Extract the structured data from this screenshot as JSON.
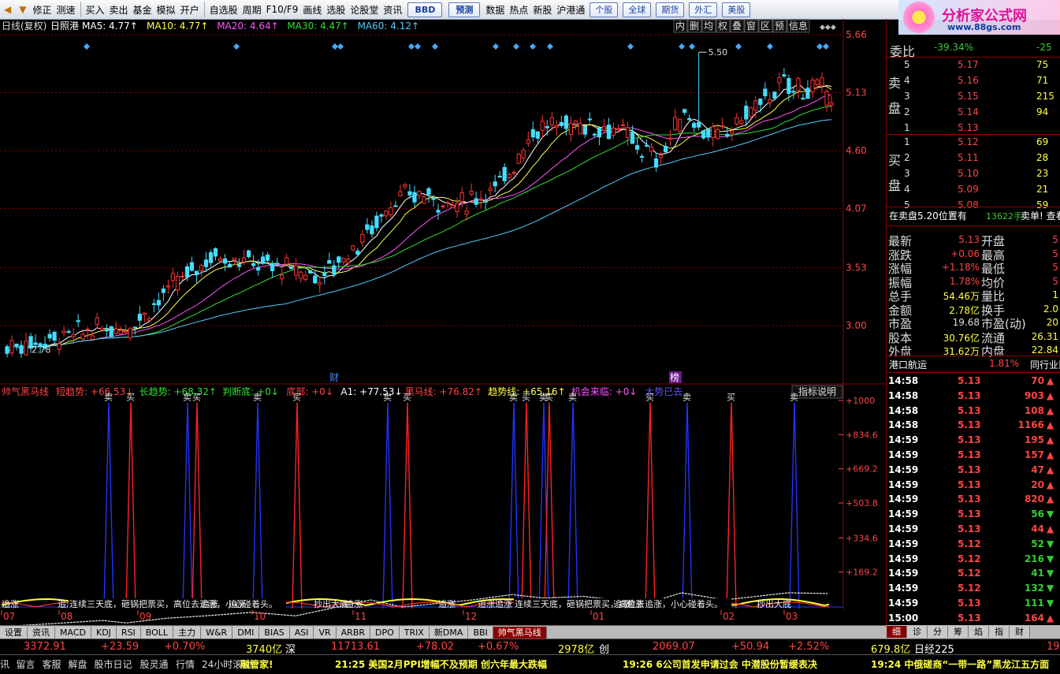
{
  "toolbar": {
    "items": [
      "修正",
      "测速",
      "买入",
      "卖出",
      "基金",
      "模拟",
      "开户",
      "自选股",
      "周期",
      "F10/F9",
      "画线",
      "选股",
      "论股堂",
      "资讯",
      "BBD",
      "预测",
      "数据",
      "热点",
      "新股",
      "沪港通",
      "个股",
      "全球",
      "期货",
      "外汇",
      "美股"
    ]
  },
  "logo": {
    "title": "分析家公式网",
    "url": "www.88gs.com"
  },
  "main_chart": {
    "header": [
      {
        "text": "日线(复权)",
        "color": "#dddddd"
      },
      {
        "text": "日照港",
        "color": "#ffffff"
      },
      {
        "text": "MA5: 4.77↑",
        "color": "#ffffff"
      },
      {
        "text": "MA10: 4.77↑",
        "color": "#ffff44"
      },
      {
        "text": "MA20: 4.64↑",
        "color": "#ff55ff"
      },
      {
        "text": "MA30: 4.47↑",
        "color": "#33dd33"
      },
      {
        "text": "MA60: 4.12↑",
        "color": "#55ccff"
      }
    ],
    "toolbar_icons": [
      "内",
      "删",
      "均",
      "权",
      "叠",
      "窗",
      "区",
      "预",
      "信息"
    ],
    "price_labels": [
      "5.66",
      "5.13",
      "4.60",
      "4.07",
      "3.53",
      "3.00"
    ],
    "high_mark": "5.50",
    "low_mark": "2.78",
    "event_labels": [
      "财",
      "榜"
    ],
    "colors": {
      "up": "#ff3333",
      "down": "#44ddff",
      "ma5": "#ffffff",
      "ma10": "#ffff44",
      "ma20": "#ff55ff",
      "ma30": "#33dd33",
      "ma60": "#55ccff",
      "grid": "#8a0000"
    }
  },
  "indicator": {
    "header": [
      {
        "text": "帅气黑马线",
        "color": "#ff4444"
      },
      {
        "text": "短趋势: +66.53↓",
        "color": "#ff4444"
      },
      {
        "text": "长趋势: +68.32↑",
        "color": "#33dd33"
      },
      {
        "text": "判断底: +0↓",
        "color": "#33dd33"
      },
      {
        "text": "底部: +0↓",
        "color": "#ff4444"
      },
      {
        "text": "A1: +77.53↓",
        "color": "#ffffff"
      },
      {
        "text": "黑马线: +76.82↑",
        "color": "#ff4444"
      },
      {
        "text": "趋势线: +65.16↑",
        "color": "#ffff44"
      },
      {
        "text": "机会来临: +0↓",
        "color": "#ff55ff"
      },
      {
        "text": "大势已去",
        "color": "#5555ff"
      }
    ],
    "explain_button": "指标说明",
    "scale_labels": [
      "+1000",
      "+834.6",
      "+669.2",
      "+503.8",
      "+334.6",
      "+169.2"
    ],
    "sell_label": "卖",
    "buy_label": "买",
    "bottom_texts": [
      "追涨",
      "追涨",
      "连续三天底，砸锅把票买，高位去追涨，小心碰着头。",
      "追涨",
      "追涨",
      "抄出大底",
      "追涨",
      "追涨",
      "追涨",
      "追涨",
      "连续三天底，砸锅把票买，高位去追涨，小心碰着头。",
      "追涨",
      "追涨",
      "抄出大底"
    ],
    "month_labels": [
      "07",
      "08",
      "09",
      "10",
      "11",
      "12",
      "01",
      "02",
      "03"
    ]
  },
  "right_panel": {
    "wei_bi_label": "委比",
    "wei_bi_value": "-39.34%",
    "wei_cha_value": "-25",
    "sell_title": "卖盘",
    "buy_title": "买盘",
    "asks": [
      {
        "level": "5",
        "price": "5.17",
        "vol": "75"
      },
      {
        "level": "4",
        "price": "5.16",
        "vol": "71"
      },
      {
        "level": "3",
        "price": "5.15",
        "vol": "215"
      },
      {
        "level": "2",
        "price": "5.14",
        "vol": "94"
      },
      {
        "level": "1",
        "price": "5.13",
        "vol": ""
      }
    ],
    "bids": [
      {
        "level": "1",
        "price": "5.12",
        "vol": "69"
      },
      {
        "level": "2",
        "price": "5.11",
        "vol": "28"
      },
      {
        "level": "3",
        "price": "5.10",
        "vol": "23"
      },
      {
        "level": "4",
        "price": "5.09",
        "vol": "21"
      },
      {
        "level": "5",
        "price": "5.08",
        "vol": "59"
      }
    ],
    "notice": "在卖盘5.20位置有",
    "notice_vol": "13622手",
    "notice_tail": "卖单! 查看详",
    "stats": [
      {
        "l1": "最新",
        "v1": "5.13",
        "l2": "开盘",
        "v2": "5"
      },
      {
        "l1": "涨跌",
        "v1": "+0.06",
        "l2": "最高",
        "v2": "5"
      },
      {
        "l1": "涨幅",
        "v1": "+1.18%",
        "l2": "最低",
        "v2": "5"
      },
      {
        "l1": "振幅",
        "v1": "1.78%",
        "l2": "均价",
        "v2": "5"
      },
      {
        "l1": "总手",
        "v1": "54.46万",
        "l2": "量比",
        "v2": "1"
      },
      {
        "l1": "金额",
        "v1": "2.78亿",
        "l2": "换手",
        "v2": "2.0"
      },
      {
        "l1": "市盈",
        "v1": "19.68",
        "l2": "市盈(动)",
        "v2": "20"
      },
      {
        "l1": "股本",
        "v1": "30.76亿",
        "l2": "流通",
        "v2": "26.31"
      },
      {
        "l1": "外盘",
        "v1": "31.62万",
        "l2": "内盘",
        "v2": "22.84"
      }
    ],
    "sector": {
      "name": "港口航运",
      "change": "1.81%",
      "link": "同行业比"
    },
    "ticks": [
      {
        "time": "14:58",
        "price": "5.13",
        "vol": "70",
        "dir": "up"
      },
      {
        "time": "14:58",
        "price": "5.13",
        "vol": "903",
        "dir": "up"
      },
      {
        "time": "14:58",
        "price": "5.13",
        "vol": "108",
        "dir": "up"
      },
      {
        "time": "14:58",
        "price": "5.13",
        "vol": "1166",
        "dir": "up"
      },
      {
        "time": "14:59",
        "price": "5.13",
        "vol": "195",
        "dir": "up"
      },
      {
        "time": "14:59",
        "price": "5.13",
        "vol": "157",
        "dir": "up"
      },
      {
        "time": "14:59",
        "price": "5.13",
        "vol": "47",
        "dir": "up"
      },
      {
        "time": "14:59",
        "price": "5.13",
        "vol": "20",
        "dir": "up"
      },
      {
        "time": "14:59",
        "price": "5.13",
        "vol": "820",
        "dir": "up"
      },
      {
        "time": "14:59",
        "price": "5.13",
        "vol": "56",
        "dir": "down"
      },
      {
        "time": "14:59",
        "price": "5.13",
        "vol": "44",
        "dir": "up"
      },
      {
        "time": "14:59",
        "price": "5.12",
        "vol": "52",
        "dir": "down"
      },
      {
        "time": "14:59",
        "price": "5.12",
        "vol": "216",
        "dir": "down"
      },
      {
        "time": "14:59",
        "price": "5.12",
        "vol": "41",
        "dir": "down"
      },
      {
        "time": "14:59",
        "price": "5.12",
        "vol": "132",
        "dir": "down"
      },
      {
        "time": "14:59",
        "price": "5.13",
        "vol": "111",
        "dir": "down"
      },
      {
        "time": "15:00",
        "price": "5.13",
        "vol": "164",
        "dir": "up"
      }
    ]
  },
  "bottom_tabs": [
    "设置",
    "资讯",
    "MACD",
    "KDJ",
    "RSI",
    "BOLL",
    "主力",
    "W&R",
    "DMI",
    "BIAS",
    "ASI",
    "VR",
    "ARBR",
    "DPO",
    "TRIX",
    "新DMA",
    "BBI",
    "帅气黑马线"
  ],
  "right_tabs": [
    "细",
    "诊",
    "分",
    "筹",
    "焰",
    "指",
    "财"
  ],
  "status1": {
    "sh_index": "3372.91",
    "sh_change": "+23.59",
    "sh_pct": "+0.70%",
    "sh_amount": "3740亿",
    "sz_label": "深",
    "sz_index": "11713.61",
    "sz_change": "+78.02",
    "sz_pct": "+0.67%",
    "sz_amount": "2978亿",
    "cy_label": "创",
    "cy_index": "2069.07",
    "cy_change": "+50.94",
    "cy_pct": "+2.52%",
    "cy_amount": "679.8亿",
    "nk_label": "日经225",
    "nk_tail": "19"
  },
  "status2": {
    "items": [
      "讯",
      "留言",
      "客服",
      "解盘",
      "股市日记",
      "股灵通",
      "行情",
      "24小时滚动"
    ],
    "brand": "融管家!",
    "news1": "21:25 美国2月PPI增幅不及预期 创六年最大跌幅",
    "news2": "19:26 6公司首发申请过会 中潜股份暂缓表决",
    "news3": "19:24 中俄磋商“一带一路”黑龙江五方面"
  }
}
